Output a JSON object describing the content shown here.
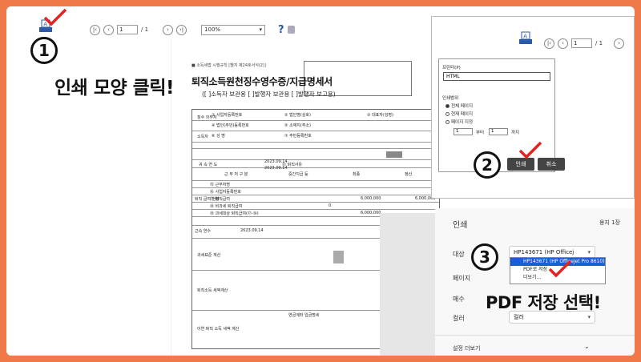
{
  "viewer": {
    "page_value": "1",
    "page_total": "/ 1",
    "zoom": "100%",
    "help": "?"
  },
  "document": {
    "note": "■ 소득세법 시행규칙 [별지 제24호서식(2)]",
    "title": "퇴직소득원천징수영수증/지급명세서",
    "subtitle": "([ ]소득자 보관용 [ ]발행자 보관용 [ ]발행자 보고용)",
    "rows": [
      "① 사업자등록번호",
      "② 법인명(상호)",
      "③ 대표자(성명)",
      "④ 법인(주민)등록번호",
      "⑤ 소재지(주소)",
      "⑥ 성 명",
      "⑦ 주민등록번호",
      "귀 속 연 도",
      "⑬ 퇴직사유",
      "근 무 처 구 분",
      "중간지급 등",
      "최종",
      "정산",
      "⑮ 근무처명",
      "⑯ 사업자등록번호",
      "⑰ 퇴직급여",
      "⑱ 비과세 퇴직급여",
      "⑲ 과세대상 퇴직급여(⑰-⑱)",
      "과세표준 계산",
      "퇴직소득 세액계산",
      "이연 퇴직 소득 세액 계산",
      "연금계좌 입금명세"
    ],
    "side_labels": [
      "징수 의무자",
      "소득자",
      "퇴직 급여 현황",
      "근속 연수"
    ],
    "values": [
      "6,000,000",
      "6,000,000",
      "0",
      "6,000,000"
    ],
    "dates": [
      "2023.09.14",
      "2023.09.14",
      "2023.09.14"
    ]
  },
  "step1": {
    "number": "1",
    "text": "인쇄 모양 클릭!"
  },
  "step2": {
    "number": "2"
  },
  "step3": {
    "number": "3",
    "text": "PDF 저장 선택!"
  },
  "dialog": {
    "page_value": "1",
    "page_total": "/ 1",
    "printer_label": "프린터(P)",
    "printer_value": "HTML",
    "range_label": "인쇄범위",
    "range_all": "전체 페이지",
    "range_current": "현재 페이지",
    "range_select": "페이지 지정",
    "from": "1",
    "from_label": "부터",
    "to": "1",
    "to_label": "까지",
    "print_button": "인쇄",
    "cancel_button": "취소"
  },
  "chrome_print": {
    "title": "인쇄",
    "sheets": "용지 1장",
    "dest_label": "대상",
    "dest_value": "HP143671 (HP Officej",
    "pages_label": "페이지",
    "copies_label": "매수",
    "color_label": "컬러",
    "color_value": "컬러",
    "more_settings": "설정 더보기",
    "dropdown": [
      "HP143671 (HP OfficeJet Pro 8610)",
      "PDF로 저장",
      "더보기..."
    ]
  },
  "colors": {
    "check": "#e52222",
    "accent": "#1a5fd6",
    "button": "#444444"
  }
}
